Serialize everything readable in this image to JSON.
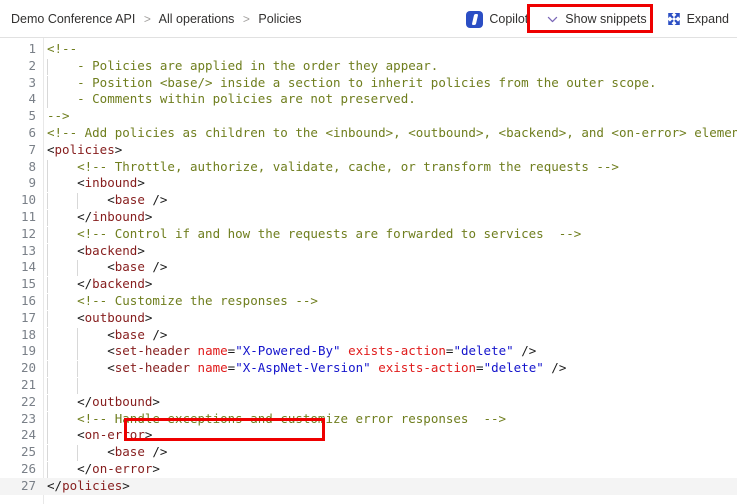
{
  "header": {
    "breadcrumb": {
      "items": [
        "Demo Conference API",
        "All operations",
        "Policies"
      ],
      "separator": ">"
    },
    "actions": {
      "copilot": {
        "label": "Copilot",
        "icon": "copilot-icon"
      },
      "show_snippets": {
        "label": "Show snippets",
        "icon": "chevron-down-icon"
      },
      "expand": {
        "label": "Expand",
        "icon": "expand-arrows-icon"
      }
    }
  },
  "annotations": {
    "snippets_highlight_color": "#ee0000",
    "line21_highlight_color": "#ee0000"
  },
  "editor": {
    "language": "xml",
    "current_line": 27,
    "colors": {
      "comment": "#6f7e1e",
      "tag": "#861d1d",
      "attribute_name": "#e01b1b",
      "attribute_value": "#1414cc",
      "line_number": "#7a8088"
    },
    "lines": [
      {
        "n": 1,
        "indent": 0,
        "tokens": [
          {
            "t": "comment",
            "s": "<!--"
          }
        ]
      },
      {
        "n": 2,
        "indent": 1,
        "tokens": [
          {
            "t": "comment",
            "s": "    - Policies are applied in the order they appear."
          }
        ]
      },
      {
        "n": 3,
        "indent": 1,
        "tokens": [
          {
            "t": "comment",
            "s": "    - Position <base/> inside a section to inherit policies from the outer scope."
          }
        ]
      },
      {
        "n": 4,
        "indent": 1,
        "tokens": [
          {
            "t": "comment",
            "s": "    - Comments within policies are not preserved."
          }
        ]
      },
      {
        "n": 5,
        "indent": 0,
        "tokens": [
          {
            "t": "comment",
            "s": "-->"
          }
        ]
      },
      {
        "n": 6,
        "indent": 0,
        "tokens": [
          {
            "t": "comment",
            "s": "<!-- Add policies as children to the <inbound>, <outbound>, <backend>, and <on-error> elements."
          }
        ]
      },
      {
        "n": 7,
        "indent": 0,
        "tokens": [
          {
            "t": "punct",
            "s": "<"
          },
          {
            "t": "tag",
            "s": "policies"
          },
          {
            "t": "punct",
            "s": ">"
          }
        ]
      },
      {
        "n": 8,
        "indent": 1,
        "tokens": [
          {
            "t": "plain",
            "s": "    "
          },
          {
            "t": "comment",
            "s": "<!-- Throttle, authorize, validate, cache, or transform the requests -->"
          }
        ]
      },
      {
        "n": 9,
        "indent": 1,
        "tokens": [
          {
            "t": "plain",
            "s": "    "
          },
          {
            "t": "punct",
            "s": "<"
          },
          {
            "t": "tag",
            "s": "inbound"
          },
          {
            "t": "punct",
            "s": ">"
          }
        ]
      },
      {
        "n": 10,
        "indent": 2,
        "tokens": [
          {
            "t": "plain",
            "s": "        "
          },
          {
            "t": "punct",
            "s": "<"
          },
          {
            "t": "tag",
            "s": "base"
          },
          {
            "t": "punct",
            "s": " />"
          }
        ]
      },
      {
        "n": 11,
        "indent": 1,
        "tokens": [
          {
            "t": "plain",
            "s": "    "
          },
          {
            "t": "punct",
            "s": "</"
          },
          {
            "t": "tag",
            "s": "inbound"
          },
          {
            "t": "punct",
            "s": ">"
          }
        ]
      },
      {
        "n": 12,
        "indent": 1,
        "tokens": [
          {
            "t": "plain",
            "s": "    "
          },
          {
            "t": "comment",
            "s": "<!-- Control if and how the requests are forwarded to services  -->"
          }
        ]
      },
      {
        "n": 13,
        "indent": 1,
        "tokens": [
          {
            "t": "plain",
            "s": "    "
          },
          {
            "t": "punct",
            "s": "<"
          },
          {
            "t": "tag",
            "s": "backend"
          },
          {
            "t": "punct",
            "s": ">"
          }
        ]
      },
      {
        "n": 14,
        "indent": 2,
        "tokens": [
          {
            "t": "plain",
            "s": "        "
          },
          {
            "t": "punct",
            "s": "<"
          },
          {
            "t": "tag",
            "s": "base"
          },
          {
            "t": "punct",
            "s": " />"
          }
        ]
      },
      {
        "n": 15,
        "indent": 1,
        "tokens": [
          {
            "t": "plain",
            "s": "    "
          },
          {
            "t": "punct",
            "s": "</"
          },
          {
            "t": "tag",
            "s": "backend"
          },
          {
            "t": "punct",
            "s": ">"
          }
        ]
      },
      {
        "n": 16,
        "indent": 1,
        "tokens": [
          {
            "t": "plain",
            "s": "    "
          },
          {
            "t": "comment",
            "s": "<!-- Customize the responses -->"
          }
        ]
      },
      {
        "n": 17,
        "indent": 1,
        "tokens": [
          {
            "t": "plain",
            "s": "    "
          },
          {
            "t": "punct",
            "s": "<"
          },
          {
            "t": "tag",
            "s": "outbound"
          },
          {
            "t": "punct",
            "s": ">"
          }
        ]
      },
      {
        "n": 18,
        "indent": 2,
        "tokens": [
          {
            "t": "plain",
            "s": "        "
          },
          {
            "t": "punct",
            "s": "<"
          },
          {
            "t": "tag",
            "s": "base"
          },
          {
            "t": "punct",
            "s": " />"
          }
        ]
      },
      {
        "n": 19,
        "indent": 2,
        "tokens": [
          {
            "t": "plain",
            "s": "        "
          },
          {
            "t": "punct",
            "s": "<"
          },
          {
            "t": "tag",
            "s": "set-header"
          },
          {
            "t": "plain",
            "s": " "
          },
          {
            "t": "attr",
            "s": "name"
          },
          {
            "t": "punct",
            "s": "="
          },
          {
            "t": "val",
            "s": "\"X-Powered-By\""
          },
          {
            "t": "plain",
            "s": " "
          },
          {
            "t": "attr",
            "s": "exists-action"
          },
          {
            "t": "punct",
            "s": "="
          },
          {
            "t": "val",
            "s": "\"delete\""
          },
          {
            "t": "punct",
            "s": " />"
          }
        ]
      },
      {
        "n": 20,
        "indent": 2,
        "tokens": [
          {
            "t": "plain",
            "s": "        "
          },
          {
            "t": "punct",
            "s": "<"
          },
          {
            "t": "tag",
            "s": "set-header"
          },
          {
            "t": "plain",
            "s": " "
          },
          {
            "t": "attr",
            "s": "name"
          },
          {
            "t": "punct",
            "s": "="
          },
          {
            "t": "val",
            "s": "\"X-AspNet-Version\""
          },
          {
            "t": "plain",
            "s": " "
          },
          {
            "t": "attr",
            "s": "exists-action"
          },
          {
            "t": "punct",
            "s": "="
          },
          {
            "t": "val",
            "s": "\"delete\""
          },
          {
            "t": "punct",
            "s": " />"
          }
        ]
      },
      {
        "n": 21,
        "indent": 2,
        "tokens": []
      },
      {
        "n": 22,
        "indent": 1,
        "tokens": [
          {
            "t": "plain",
            "s": "    "
          },
          {
            "t": "punct",
            "s": "</"
          },
          {
            "t": "tag",
            "s": "outbound"
          },
          {
            "t": "punct",
            "s": ">"
          }
        ]
      },
      {
        "n": 23,
        "indent": 1,
        "tokens": [
          {
            "t": "plain",
            "s": "    "
          },
          {
            "t": "comment",
            "s": "<!-- Handle exceptions and customize error responses  -->"
          }
        ]
      },
      {
        "n": 24,
        "indent": 1,
        "tokens": [
          {
            "t": "plain",
            "s": "    "
          },
          {
            "t": "punct",
            "s": "<"
          },
          {
            "t": "tag",
            "s": "on-error"
          },
          {
            "t": "punct",
            "s": ">"
          }
        ]
      },
      {
        "n": 25,
        "indent": 2,
        "tokens": [
          {
            "t": "plain",
            "s": "        "
          },
          {
            "t": "punct",
            "s": "<"
          },
          {
            "t": "tag",
            "s": "base"
          },
          {
            "t": "punct",
            "s": " />"
          }
        ]
      },
      {
        "n": 26,
        "indent": 1,
        "tokens": [
          {
            "t": "plain",
            "s": "    "
          },
          {
            "t": "punct",
            "s": "</"
          },
          {
            "t": "tag",
            "s": "on-error"
          },
          {
            "t": "punct",
            "s": ">"
          }
        ]
      },
      {
        "n": 27,
        "indent": 0,
        "tokens": [
          {
            "t": "punct",
            "s": "</"
          },
          {
            "t": "tag",
            "s": "policies"
          },
          {
            "t": "punct",
            "s": ">"
          }
        ]
      }
    ]
  }
}
